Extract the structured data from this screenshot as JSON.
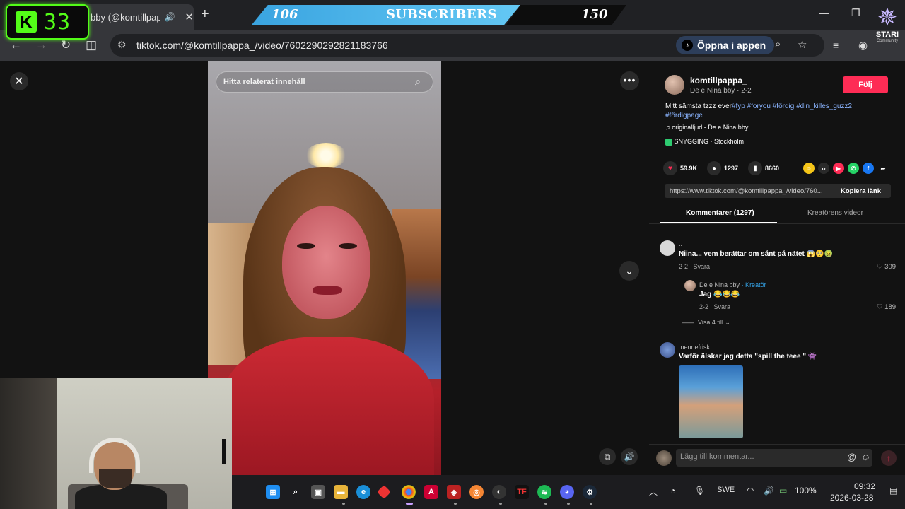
{
  "overlay": {
    "kick_count": "33",
    "kick_logo": "K",
    "subscribers": {
      "current": "106",
      "label": "SUBSCRIBERS",
      "goal": "150"
    },
    "community": {
      "name": "STARI",
      "tagline": "Community"
    }
  },
  "browser": {
    "tab_title": "bby (@komtillpappa_",
    "url": "tiktok.com/@komtillpappa_/video/7602290292821183766",
    "open_app_label": "Öppna i appen"
  },
  "video": {
    "search_placeholder": "Hitta relaterat innehåll"
  },
  "post": {
    "username": "komtillpappa_",
    "subtitle": "De e Nina bby · 2-2",
    "follow_label": "Följ",
    "caption_text": "Mitt sämsta tzzz ever",
    "hashtags": [
      "#fyp",
      "#foryou",
      "#fördig",
      "#din_killes_guzz2",
      "#fördigpage"
    ],
    "sound": "originalljud - De e Nina bby",
    "location": "SNYGGING · Stockholm",
    "likes": "59.9K",
    "comments": "1297",
    "saves": "8660",
    "link": "https://www.tiktok.com/@komtillpappa_/video/760...",
    "copy_label": "Kopiera länk"
  },
  "tabs": {
    "comments": "Kommentarer (1297)",
    "creator_videos": "Kreatörens videor"
  },
  "comments": [
    {
      "name": "..",
      "text": "Niina... vem berättar om sånt på nätet 😱🥺🤢",
      "date": "2-2",
      "reply": "Svara",
      "likes": "309"
    },
    {
      "name": "De e Nina bby",
      "badge": "· Kreatör",
      "text": "Jag 😂😂😂",
      "date": "2-2",
      "reply": "Svara",
      "likes": "189"
    },
    {
      "name": ".nennefrisk",
      "text": "Varför älskar jag detta \"spill the teee \" 👾"
    }
  ],
  "show_more": "Visa 4 till",
  "comment_input": {
    "placeholder": "Lägg till kommentar..."
  },
  "taskbar": {
    "language": "SWE",
    "battery": "100%",
    "time": "09:32",
    "date": "2026-03-28"
  },
  "colors": {
    "accent": "#fe2c55",
    "kick_green": "#53fc18",
    "sub_blue": "#3aa4e0",
    "hashtag": "#8ab4ff"
  },
  "icons": [
    "close-icon",
    "search-icon",
    "more-icon",
    "chevron-down-icon",
    "heart-icon",
    "comment-icon",
    "bookmark-icon",
    "music-note-icon",
    "location-icon",
    "share-icon"
  ]
}
